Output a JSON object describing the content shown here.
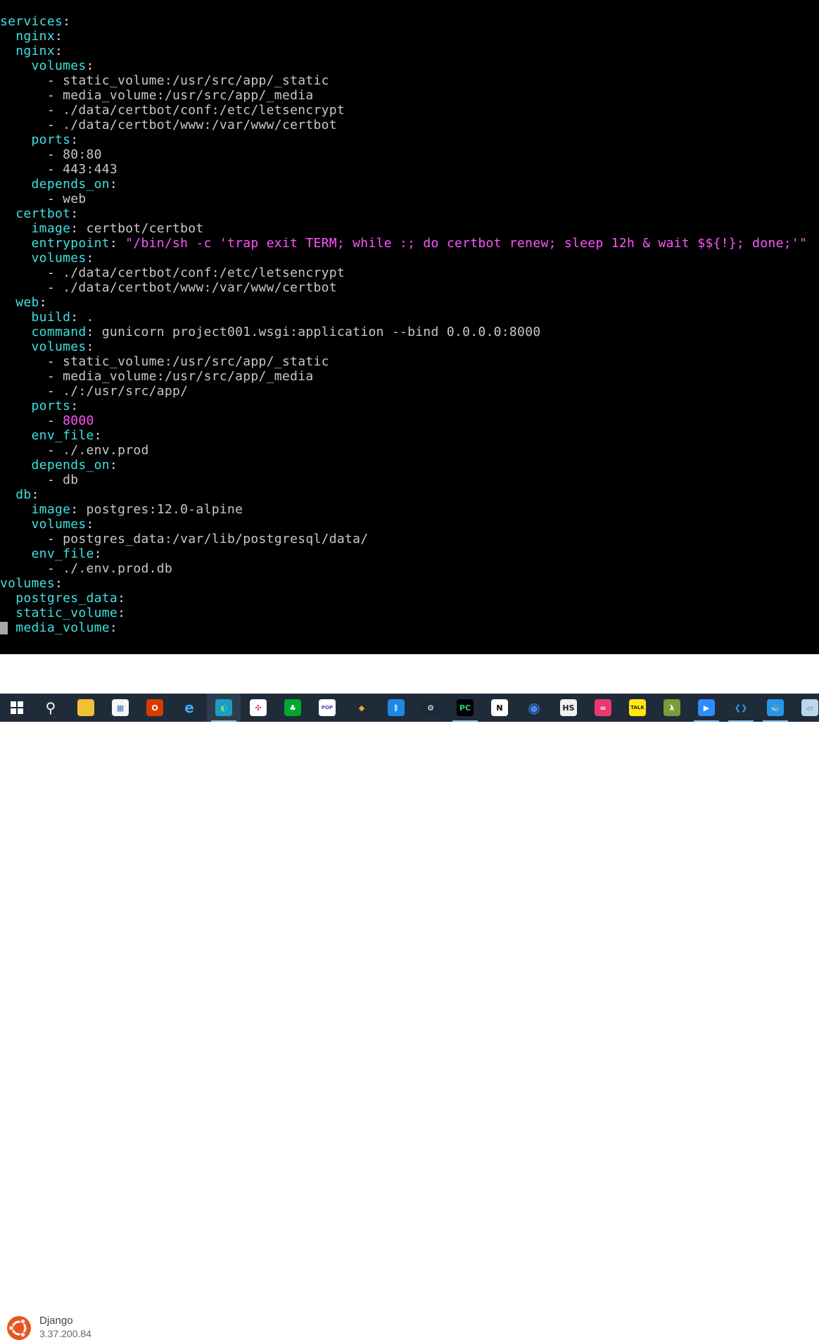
{
  "terminal": {
    "lines": [
      [
        {
          "c": "k",
          "t": "services"
        },
        {
          "c": "p",
          "t": ":"
        }
      ],
      [
        {
          "c": "k",
          "t": "  nginx"
        },
        {
          "c": "p",
          "t": ":"
        }
      ],
      [
        {
          "c": "k",
          "t": "  nginx"
        },
        {
          "c": "p",
          "t": ":"
        }
      ],
      [
        {
          "c": "k",
          "t": "    volumes"
        },
        {
          "c": "p",
          "t": ":"
        }
      ],
      [
        {
          "c": "d",
          "t": "      - "
        },
        {
          "c": "v",
          "t": "static_volume:/usr/src/app/_static"
        }
      ],
      [
        {
          "c": "d",
          "t": "      - "
        },
        {
          "c": "v",
          "t": "media_volume:/usr/src/app/_media"
        }
      ],
      [
        {
          "c": "d",
          "t": "      - "
        },
        {
          "c": "v",
          "t": "./data/certbot/conf:/etc/letsencrypt"
        }
      ],
      [
        {
          "c": "d",
          "t": "      - "
        },
        {
          "c": "v",
          "t": "./data/certbot/www:/var/www/certbot"
        }
      ],
      [
        {
          "c": "k",
          "t": "    ports"
        },
        {
          "c": "p",
          "t": ":"
        }
      ],
      [
        {
          "c": "d",
          "t": "      - "
        },
        {
          "c": "v",
          "t": "80:80"
        }
      ],
      [
        {
          "c": "d",
          "t": "      - "
        },
        {
          "c": "v",
          "t": "443:443"
        }
      ],
      [
        {
          "c": "k",
          "t": "    depends_on"
        },
        {
          "c": "p",
          "t": ":"
        }
      ],
      [
        {
          "c": "d",
          "t": "      - "
        },
        {
          "c": "v",
          "t": "web"
        }
      ],
      [
        {
          "c": "k",
          "t": "  certbot"
        },
        {
          "c": "p",
          "t": ":"
        }
      ],
      [
        {
          "c": "k",
          "t": "    image"
        },
        {
          "c": "p",
          "t": ": "
        },
        {
          "c": "v",
          "t": "certbot/certbot"
        }
      ],
      [
        {
          "c": "k",
          "t": "    entrypoint"
        },
        {
          "c": "p",
          "t": ": "
        },
        {
          "c": "s",
          "t": "\"/bin/sh -c 'trap exit TERM; while :; do certbot renew; sleep 12h & wait $${!}; done;'\""
        }
      ],
      [
        {
          "c": "k",
          "t": "    volumes"
        },
        {
          "c": "p",
          "t": ":"
        }
      ],
      [
        {
          "c": "d",
          "t": "      - "
        },
        {
          "c": "v",
          "t": "./data/certbot/conf:/etc/letsencrypt"
        }
      ],
      [
        {
          "c": "d",
          "t": "      - "
        },
        {
          "c": "v",
          "t": "./data/certbot/www:/var/www/certbot"
        }
      ],
      [
        {
          "c": "k",
          "t": "  web"
        },
        {
          "c": "p",
          "t": ":"
        }
      ],
      [
        {
          "c": "k",
          "t": "    build"
        },
        {
          "c": "p",
          "t": ": "
        },
        {
          "c": "v",
          "t": "."
        }
      ],
      [
        {
          "c": "k",
          "t": "    command"
        },
        {
          "c": "p",
          "t": ": "
        },
        {
          "c": "v",
          "t": "gunicorn project001.wsgi:application --bind 0.0.0.0:8000"
        }
      ],
      [
        {
          "c": "k",
          "t": "    volumes"
        },
        {
          "c": "p",
          "t": ":"
        }
      ],
      [
        {
          "c": "d",
          "t": "      - "
        },
        {
          "c": "v",
          "t": "static_volume:/usr/src/app/_static"
        }
      ],
      [
        {
          "c": "d",
          "t": "      - "
        },
        {
          "c": "v",
          "t": "media_volume:/usr/src/app/_media"
        }
      ],
      [
        {
          "c": "d",
          "t": "      - "
        },
        {
          "c": "v",
          "t": "./:/usr/src/app/"
        }
      ],
      [
        {
          "c": "k",
          "t": "    ports"
        },
        {
          "c": "p",
          "t": ":"
        }
      ],
      [
        {
          "c": "d",
          "t": "      - "
        },
        {
          "c": "n",
          "t": "8000"
        }
      ],
      [
        {
          "c": "k",
          "t": "    env_file"
        },
        {
          "c": "p",
          "t": ":"
        }
      ],
      [
        {
          "c": "d",
          "t": "      - "
        },
        {
          "c": "v",
          "t": "./.env.prod"
        }
      ],
      [
        {
          "c": "k",
          "t": "    depends_on"
        },
        {
          "c": "p",
          "t": ":"
        }
      ],
      [
        {
          "c": "d",
          "t": "      - "
        },
        {
          "c": "v",
          "t": "db"
        }
      ],
      [
        {
          "c": "k",
          "t": "  db"
        },
        {
          "c": "p",
          "t": ":"
        }
      ],
      [
        {
          "c": "k",
          "t": "    image"
        },
        {
          "c": "p",
          "t": ": "
        },
        {
          "c": "v",
          "t": "postgres:12.0-alpine"
        }
      ],
      [
        {
          "c": "k",
          "t": "    volumes"
        },
        {
          "c": "p",
          "t": ":"
        }
      ],
      [
        {
          "c": "d",
          "t": "      - "
        },
        {
          "c": "v",
          "t": "postgres_data:/var/lib/postgresql/data/"
        }
      ],
      [
        {
          "c": "k",
          "t": "    env_file"
        },
        {
          "c": "p",
          "t": ":"
        }
      ],
      [
        {
          "c": "d",
          "t": "      - "
        },
        {
          "c": "v",
          "t": "./.env.prod.db"
        }
      ],
      [
        {
          "c": "k",
          "t": "volumes"
        },
        {
          "c": "p",
          "t": ":"
        }
      ],
      [
        {
          "c": "k",
          "t": "  postgres_data"
        },
        {
          "c": "p",
          "t": ":"
        }
      ],
      [
        {
          "c": "k",
          "t": "  static_volume"
        },
        {
          "c": "p",
          "t": ":"
        }
      ],
      [
        {
          "c": "k",
          "t": "  media_volume"
        },
        {
          "c": "p",
          "t": ":"
        }
      ]
    ]
  },
  "banner": {
    "title": "Django",
    "subtitle": "3.37.200.84"
  },
  "taskbar": {
    "icons": [
      {
        "name": "windows-start-icon",
        "glyph": "",
        "bg": "transparent",
        "color": "#ffffff",
        "active": false,
        "underline": false
      },
      {
        "name": "search-icon",
        "glyph": "⚲",
        "bg": "transparent",
        "color": "#ffffff",
        "active": false,
        "underline": false
      },
      {
        "name": "file-explorer-icon",
        "glyph": "▬",
        "bg": "#f2c037",
        "color": "#f2c037",
        "active": false,
        "underline": false
      },
      {
        "name": "microsoft-store-icon",
        "glyph": "▦",
        "bg": "#f5f5f5",
        "color": "#3a77c9",
        "active": false,
        "underline": false
      },
      {
        "name": "office-icon",
        "glyph": "O",
        "bg": "#d83b01",
        "color": "#ffffff",
        "active": false,
        "underline": false
      },
      {
        "name": "internet-explorer-icon",
        "glyph": "e",
        "bg": "transparent",
        "color": "#3fa9f5",
        "active": false,
        "underline": false
      },
      {
        "name": "edge-icon",
        "glyph": "◐",
        "bg": "#1a9ec4",
        "color": "#6fe07a",
        "active": true,
        "underline": true
      },
      {
        "name": "slack-icon",
        "glyph": "✣",
        "bg": "#ffffff",
        "color": "#e01e5a",
        "active": false,
        "underline": false
      },
      {
        "name": "evernote-icon",
        "glyph": "♣",
        "bg": "#00a82d",
        "color": "#ffffff",
        "active": false,
        "underline": false
      },
      {
        "name": "pophts-icon",
        "glyph": "POP",
        "bg": "#ffffff",
        "color": "#5a3fb0",
        "active": false,
        "underline": false
      },
      {
        "name": "sourcetree-icon",
        "glyph": "◆",
        "bg": "transparent",
        "color": "#e8a33a",
        "active": false,
        "underline": false
      },
      {
        "name": "bluetooth-icon",
        "glyph": "ᛒ",
        "bg": "#1e88e5",
        "color": "#ffffff",
        "active": false,
        "underline": false
      },
      {
        "name": "steam-icon",
        "glyph": "⚙",
        "bg": "#1b2838",
        "color": "#ffffff",
        "active": false,
        "underline": false
      },
      {
        "name": "pycharm-icon",
        "glyph": "PC",
        "bg": "#000000",
        "color": "#21d789",
        "active": false,
        "underline": true
      },
      {
        "name": "notion-icon",
        "glyph": "N",
        "bg": "#ffffff",
        "color": "#000000",
        "active": false,
        "underline": false
      },
      {
        "name": "chrome-icon",
        "glyph": "◉",
        "bg": "transparent",
        "color": "#4285f4",
        "active": false,
        "underline": false
      },
      {
        "name": "hs-icon",
        "glyph": "HS",
        "bg": "#f0f0f0",
        "color": "#222222",
        "active": false,
        "underline": false
      },
      {
        "name": "creative-cloud-icon",
        "glyph": "∞",
        "bg": "#e83a6e",
        "color": "#ffffff",
        "active": false,
        "underline": false
      },
      {
        "name": "kakaotalk-icon",
        "glyph": "TALK",
        "bg": "#ffe812",
        "color": "#3c1e1e",
        "active": false,
        "underline": false
      },
      {
        "name": "lambda-icon",
        "glyph": "λ",
        "bg": "#7d9a3a",
        "color": "#ffffff",
        "active": false,
        "underline": false
      },
      {
        "name": "zoom-icon",
        "glyph": "▶",
        "bg": "#2d8cff",
        "color": "#ffffff",
        "active": false,
        "underline": true
      },
      {
        "name": "vscode-icon",
        "glyph": "❮❯",
        "bg": "transparent",
        "color": "#2f9ff0",
        "active": false,
        "underline": true
      },
      {
        "name": "docker-icon",
        "glyph": "🐳",
        "bg": "#2496ed",
        "color": "#ffffff",
        "active": false,
        "underline": true
      },
      {
        "name": "notepad-icon",
        "glyph": "▱",
        "bg": "#b9d8ee",
        "color": "#4a7fa8",
        "active": false,
        "underline": false
      }
    ]
  }
}
